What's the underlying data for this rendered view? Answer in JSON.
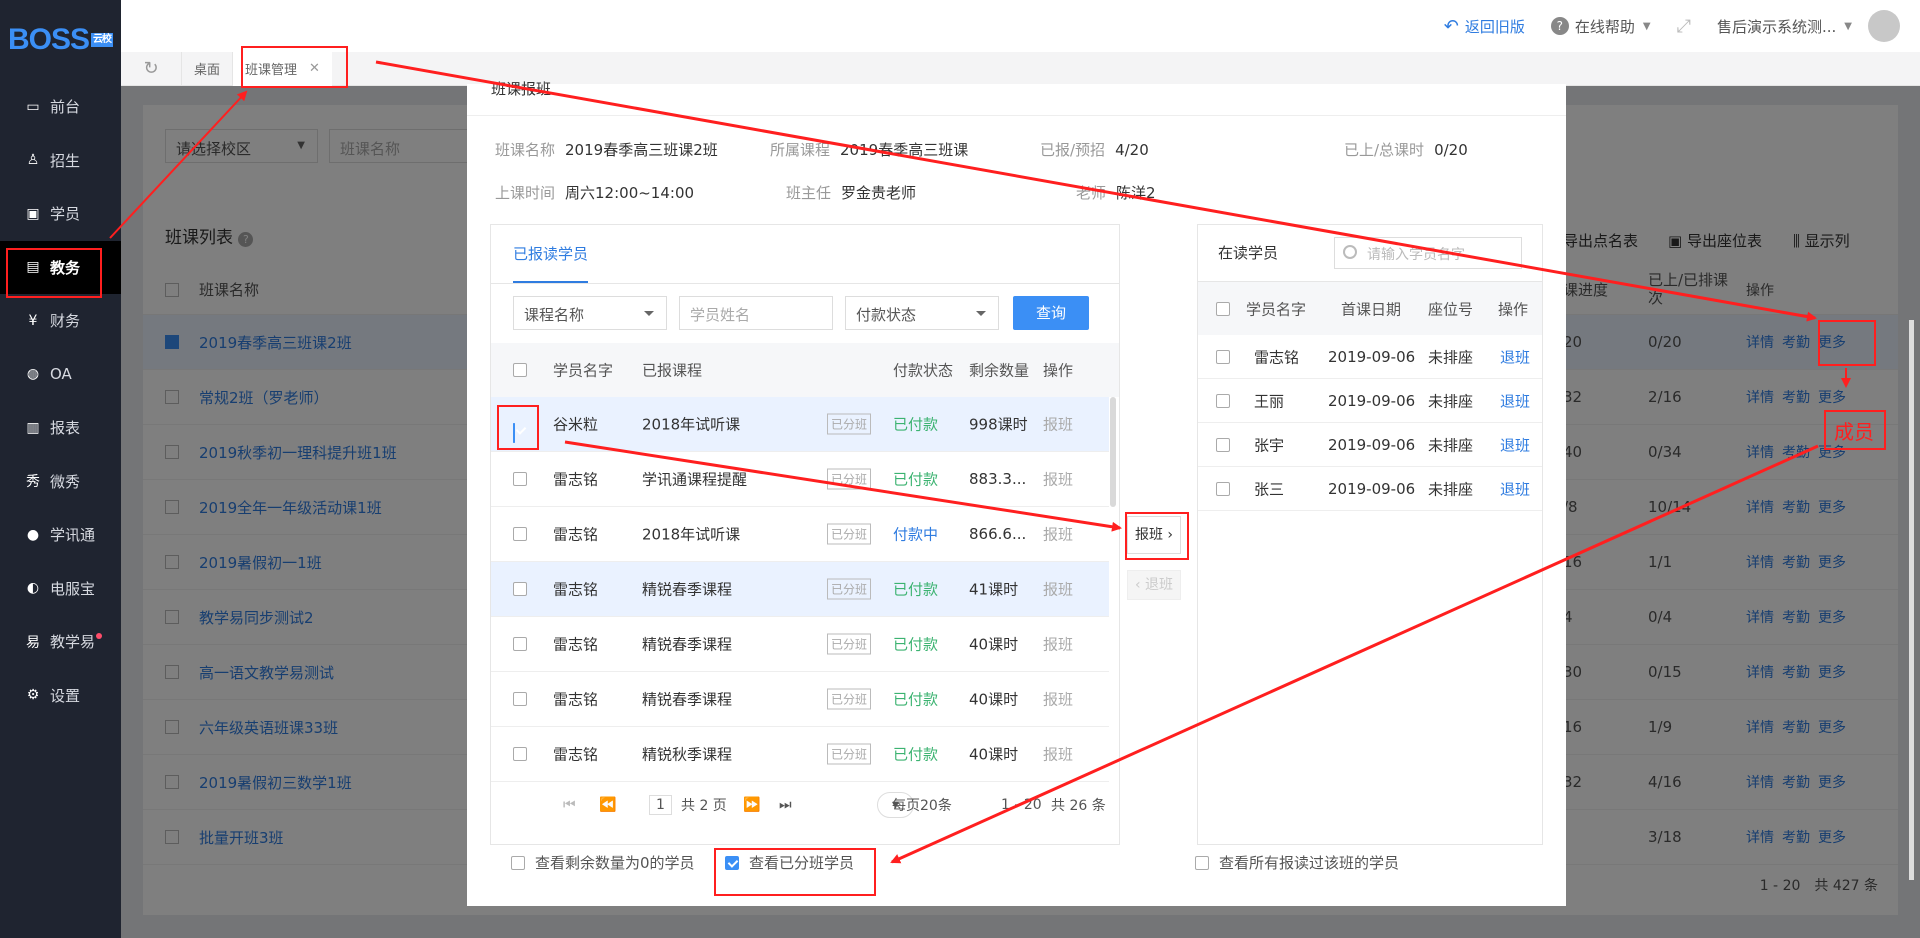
{
  "logo": "BOSS",
  "logo_badge": "云校",
  "sidebar": {
    "items": [
      {
        "label": "前台",
        "icon": "calendar-icon"
      },
      {
        "label": "招生",
        "icon": "user-plus-icon"
      },
      {
        "label": "学员",
        "icon": "id-card-icon"
      },
      {
        "label": "教务",
        "icon": "book-icon"
      },
      {
        "label": "财务",
        "icon": "yen-icon"
      },
      {
        "label": "OA",
        "icon": "chat-icon"
      },
      {
        "label": "报表",
        "icon": "bar-chart-icon"
      },
      {
        "label": "微秀",
        "icon": "xiu-icon"
      },
      {
        "label": "学讯通",
        "icon": "location-icon"
      },
      {
        "label": "电服宝",
        "icon": "phone-icon"
      },
      {
        "label": "教学易",
        "icon": "teach-icon"
      },
      {
        "label": "设置",
        "icon": "gear-icon"
      }
    ]
  },
  "topbar": {
    "back": "返回旧版",
    "help": "在线帮助",
    "account": "售后演示系统测..."
  },
  "tabs": {
    "desk": "桌面",
    "active": "班课管理"
  },
  "background": {
    "filter_campus": "请选择校区",
    "filter_name": "班课名称",
    "list_title": "班课列表",
    "col_name": "班课名称",
    "col_progress": "课进度",
    "col_rate_1": "已上/已排课",
    "col_rate_2": "次",
    "col_ops": "操作",
    "tool_export_roll": "导出点名表",
    "tool_export_seat": "导出座位表",
    "tool_columns": "显示列",
    "rows": [
      {
        "name": "2019春季高三班课2班",
        "prog": "20",
        "rate": "0/20"
      },
      {
        "name": "常规2班（罗老师）",
        "prog": "32",
        "rate": "2/16"
      },
      {
        "name": "2019秋季初一理科提升班1班",
        "prog": "40",
        "rate": "0/34"
      },
      {
        "name": "2019全年一年级活动课1班",
        "prog": "/8",
        "rate": "10/14"
      },
      {
        "name": "2019暑假初一1班",
        "prog": "16",
        "rate": "1/1"
      },
      {
        "name": "教学易同步测试2",
        "prog": "4",
        "rate": "0/4"
      },
      {
        "name": "高一语文教学易测试",
        "prog": "30",
        "rate": "0/15"
      },
      {
        "name": "六年级英语班课33班",
        "prog": "16",
        "rate": "1/9"
      },
      {
        "name": "2019暑假初三数学1班",
        "prog": "32",
        "rate": "4/16"
      },
      {
        "name": "批量开班3班",
        "prog": "",
        "rate": "3/18"
      }
    ],
    "op_detail": "详情",
    "op_attend": "考勤",
    "op_more": "更多",
    "footer": "1 - 20　共 427 条"
  },
  "modal": {
    "title": "班课报班",
    "info": {
      "class_name_label": "班课名称",
      "class_name": "2019春季高三班课2班",
      "course_label": "所属课程",
      "course": "2019春季高三班课",
      "enrolled_label": "已报/预招",
      "enrolled": "4/20",
      "lessons_label": "已上/总课时",
      "lessons": "0/20",
      "time_label": "上课时间",
      "time": "周六12:00~14:00",
      "head_label": "班主任",
      "head": "罗金贵老师",
      "teacher_label": "老师",
      "teacher": "陈洋2"
    },
    "left": {
      "tab": "已报读学员",
      "course_select": "课程名称",
      "student_placeholder": "学员姓名",
      "pay_select": "付款状态",
      "query": "查询",
      "headers": [
        "学员名字",
        "已报课程",
        "付款状态",
        "剩余数量",
        "操作"
      ],
      "rows": [
        {
          "name": "谷米粒",
          "course": "2018年试听课",
          "tag": "已分班",
          "pay": "已付款",
          "left": "998课时",
          "op": "报班"
        },
        {
          "name": "雷志铭",
          "course": "学讯通课程提醒",
          "tag": "已分班",
          "pay": "已付款",
          "left": "883.3...",
          "op": "报班"
        },
        {
          "name": "雷志铭",
          "course": "2018年试听课",
          "tag": "已分班",
          "pay": "付款中",
          "left": "866.6...",
          "op": "报班"
        },
        {
          "name": "雷志铭",
          "course": "精锐春季课程",
          "tag": "已分班",
          "pay": "已付款",
          "left": "41课时",
          "op": "报班"
        },
        {
          "name": "雷志铭",
          "course": "精锐春季课程",
          "tag": "已分班",
          "pay": "已付款",
          "left": "40课时",
          "op": "报班"
        },
        {
          "name": "雷志铭",
          "course": "精锐春季课程",
          "tag": "已分班",
          "pay": "已付款",
          "left": "40课时",
          "op": "报班"
        },
        {
          "name": "雷志铭",
          "course": "精锐秋季课程",
          "tag": "已分班",
          "pay": "已付款",
          "left": "40课时",
          "op": "报班"
        }
      ],
      "pager": {
        "page": "1",
        "total_pages": "共 2 页",
        "per_page": "每页20条",
        "range": "1 - 20",
        "total": "共 26 条"
      }
    },
    "mid": {
      "enroll": "报班",
      "withdraw": "退班"
    },
    "right": {
      "title": "在读学员",
      "search_placeholder": "请输入学员名字",
      "headers": [
        "学员名字",
        "首课日期",
        "座位号",
        "操作"
      ],
      "rows": [
        {
          "name": "雷志铭",
          "date": "2019-09-06",
          "seat": "未排座",
          "op": "退班"
        },
        {
          "name": "王丽",
          "date": "2019-09-06",
          "seat": "未排座",
          "op": "退班"
        },
        {
          "name": "张宇",
          "date": "2019-09-06",
          "seat": "未排座",
          "op": "退班"
        },
        {
          "name": "张三",
          "date": "2019-09-06",
          "seat": "未排座",
          "op": "退班"
        }
      ]
    },
    "footer": {
      "zero_left": "查看剩余数量为0的学员",
      "assigned": "查看已分班学员",
      "all_read": "查看所有报读过该班的学员"
    }
  },
  "annotation": {
    "label": "成员",
    "color": "#ff1f1f"
  }
}
